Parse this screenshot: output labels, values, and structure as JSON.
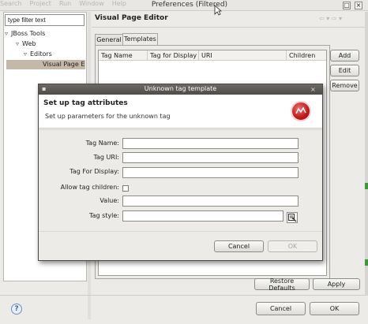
{
  "background_window": {
    "menu_items": [
      "Search",
      "Project",
      "Run",
      "Window",
      "Help"
    ],
    "title": "Preferences (Filtered)",
    "filter_value": "type filter text",
    "tree": [
      {
        "label": "JBoss Tools",
        "expanded": true
      },
      {
        "label": "Web",
        "expanded": true
      },
      {
        "label": "Editors",
        "expanded": true
      },
      {
        "label": "Visual Page E",
        "selected": true
      }
    ],
    "page_title": "Visual Page Editor",
    "tabs": [
      "General",
      "Templates"
    ],
    "active_tab": "Templates",
    "table_columns": [
      "Tag Name",
      "Tag for Display",
      "URI",
      "Children"
    ],
    "side_buttons": {
      "add": "Add",
      "edit": "Edit",
      "remove": "Remove"
    },
    "restore_defaults": "Restore Defaults",
    "apply": "Apply",
    "cancel": "Cancel",
    "ok": "OK",
    "help_icon": "?"
  },
  "dialog": {
    "title": "Unknown tag template",
    "heading": "Set up tag attributes",
    "description": "Set up parameters for the unknown tag",
    "fields": {
      "tag_name_label": "Tag Name:",
      "tag_uri_label": "Tag URI:",
      "tag_display_label": "Tag For Display:",
      "allow_children_label": "Allow tag children:",
      "value_label": "Value:",
      "tag_style_label": "Tag style:"
    },
    "values": {
      "tag_name": "",
      "tag_uri": "",
      "tag_display": "",
      "value": "",
      "tag_style": ""
    },
    "allow_children_checked": false,
    "cancel": "Cancel",
    "ok": "OK",
    "ok_enabled": false
  },
  "icons": {
    "logo": "jboss-logo-icon",
    "style_picker": "style-picker-icon",
    "help": "help-icon",
    "close": "close-icon",
    "maximize": "maximize-icon"
  },
  "colors": {
    "dialog_titlebar": "#5c5955",
    "selection": "#c4b9a8",
    "logo_red": "#c01818"
  }
}
